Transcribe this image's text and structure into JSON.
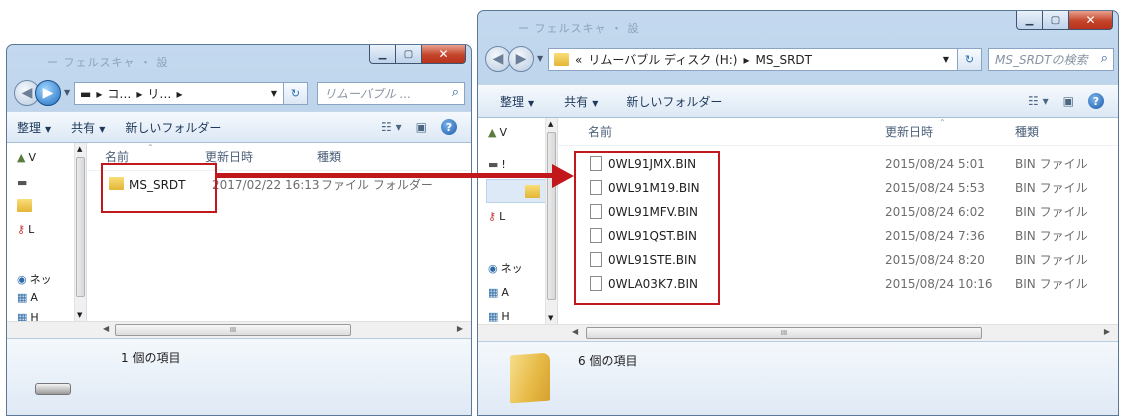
{
  "accent_color": "#c0181b",
  "left_window": {
    "title_blur": "ー フェルスキャ ・ 設",
    "address_parts": [
      "▬",
      "コ…",
      "リ…"
    ],
    "search_placeholder": "リムーバブル ...",
    "toolbar": {
      "organize": "整理",
      "share": "共有",
      "new_folder": "新しいフォルダー"
    },
    "nav_items": [
      "V",
      "",
      "",
      "L",
      "ネッ",
      "A",
      "H"
    ],
    "columns": {
      "name": "名前",
      "date": "更新日時",
      "type": "種類"
    },
    "rows": [
      {
        "name": "MS_SRDT",
        "date": "2017/02/22 16:13",
        "type": "ファイル フォルダー"
      }
    ],
    "scrollbar_grip": "III",
    "status": "1 個の項目"
  },
  "right_window": {
    "title_blur": "ー フェルスキャ ・ 設",
    "address": {
      "prefix": "«",
      "drive": "リムーバブル ディスク (H:)",
      "sep": "▸",
      "folder": "MS_SRDT"
    },
    "search_placeholder": "MS_SRDTの検索",
    "toolbar": {
      "organize": "整理",
      "share": "共有",
      "new_folder": "新しいフォルダー"
    },
    "nav_items": [
      "V",
      "!",
      "",
      "L",
      "ネッ",
      "A",
      "H"
    ],
    "columns": {
      "name": "名前",
      "date": "更新日時",
      "type": "種類"
    },
    "rows": [
      {
        "name": "0WL91JMX.BIN",
        "date": "2015/08/24 5:01",
        "type": "BIN ファイル"
      },
      {
        "name": "0WL91M19.BIN",
        "date": "2015/08/24 5:53",
        "type": "BIN ファイル"
      },
      {
        "name": "0WL91MFV.BIN",
        "date": "2015/08/24 6:02",
        "type": "BIN ファイル"
      },
      {
        "name": "0WL91QST.BIN",
        "date": "2015/08/24 7:36",
        "type": "BIN ファイル"
      },
      {
        "name": "0WL91STE.BIN",
        "date": "2015/08/24 8:20",
        "type": "BIN ファイル"
      },
      {
        "name": "0WLA03K7.BIN",
        "date": "2015/08/24 10:16",
        "type": "BIN ファイル"
      }
    ],
    "scrollbar_grip": "III",
    "status": "6 個の項目"
  }
}
